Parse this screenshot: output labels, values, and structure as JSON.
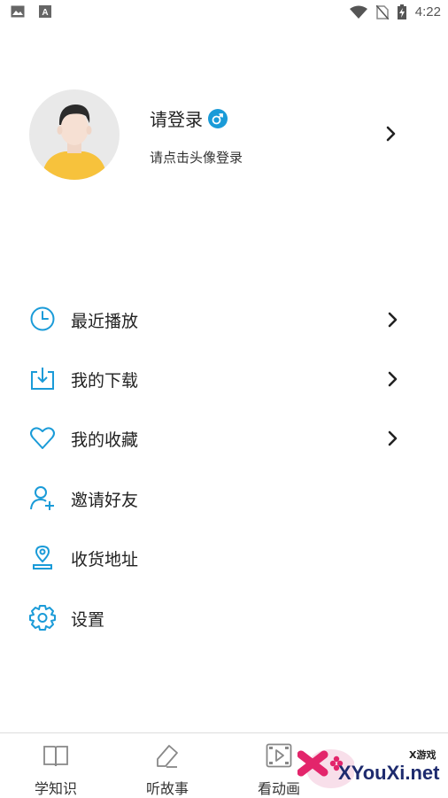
{
  "status_bar": {
    "time": "4:22",
    "left_icons": [
      "image-icon",
      "a-app-icon"
    ],
    "right_icons": [
      "wifi-icon",
      "no-sim-icon",
      "battery-charging-icon"
    ]
  },
  "profile": {
    "name": "请登录",
    "gender_icon": "male-icon",
    "subtitle": "请点击头像登录"
  },
  "menu": {
    "items": [
      {
        "label": "最近播放",
        "icon": "clock-icon",
        "has_arrow": true
      },
      {
        "label": "我的下载",
        "icon": "download-icon",
        "has_arrow": true
      },
      {
        "label": "我的收藏",
        "icon": "heart-icon",
        "has_arrow": true
      },
      {
        "label": "邀请好友",
        "icon": "add-user-icon",
        "has_arrow": false
      },
      {
        "label": "收货地址",
        "icon": "location-icon",
        "has_arrow": false
      },
      {
        "label": "设置",
        "icon": "gear-icon",
        "has_arrow": false
      }
    ]
  },
  "tabbar": {
    "tabs": [
      {
        "label": "学知识",
        "icon": "book-icon"
      },
      {
        "label": "听故事",
        "icon": "pencil-icon"
      },
      {
        "label": "看动画",
        "icon": "video-icon"
      }
    ]
  },
  "watermark": {
    "text": "XYouXi.net",
    "small": "X游戏"
  },
  "colors": {
    "accent": "#1a9bd8",
    "text": "#222222",
    "divider": "#dcdcdc",
    "avatar_bg": "#e9e9e9",
    "shirt": "#f7c23c"
  }
}
